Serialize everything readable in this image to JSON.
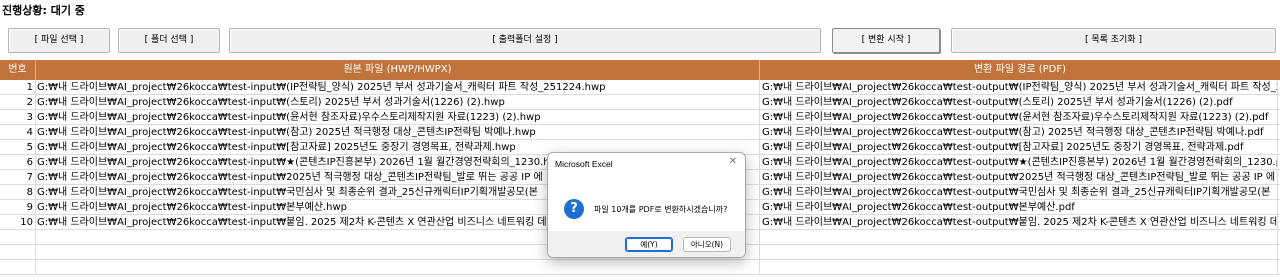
{
  "status_text": "진행상황: 대기 중",
  "buttons": {
    "file_select": "[ 파일 선택 ]",
    "folder_select": "[ 폴더 선택 ]",
    "output_folder": "[ 출력폴더 설정 ]",
    "convert_start": "[ 변환 시작 ]",
    "reset_list": "[ 목록 초기화 ]"
  },
  "table": {
    "headers": [
      "번호",
      "원본 파일 (HWP/HWPX)",
      "변환 파일 경로 (PDF)"
    ],
    "rows": [
      {
        "no": "1",
        "src": "G:₩내 드라이브₩AI_project₩26kocca₩test-input₩(IP전략팀_양식) 2025년 부서 성과기술서_캐릭터 파트 작성_251224.hwp",
        "dst": "G:₩내 드라이브₩AI_project₩26kocca₩test-output₩(IP전략팀_양식) 2025년 부서 성과기술서_캐릭터 파트 작성_2"
      },
      {
        "no": "2",
        "src": "G:₩내 드라이브₩AI_project₩26kocca₩test-input₩(스토리) 2025년 부서 성과기술서(1226) (2).hwp",
        "dst": "G:₩내 드라이브₩AI_project₩26kocca₩test-output₩(스토리) 2025년 부서 성과기술서(1226) (2).pdf"
      },
      {
        "no": "3",
        "src": "G:₩내 드라이브₩AI_project₩26kocca₩test-input₩(윤서현 참조자료)우수스토리제작지원 자료(1223) (2).hwp",
        "dst": "G:₩내 드라이브₩AI_project₩26kocca₩test-output₩(윤서현 참조자료)우수스토리제작지원 자료(1223) (2).pdf"
      },
      {
        "no": "4",
        "src": "G:₩내 드라이브₩AI_project₩26kocca₩test-input₩(참고) 2025년 적극행정 대상_콘텐츠IP전략팀 박예나.hwp",
        "dst": "G:₩내 드라이브₩AI_project₩26kocca₩test-output₩(참고) 2025년 적극행정 대상_콘텐츠IP전략팀 박예나.pdf"
      },
      {
        "no": "5",
        "src": "G:₩내 드라이브₩AI_project₩26kocca₩test-input₩[참고자료] 2025년도 중장기 경영목표, 전략과제.hwp",
        "dst": "G:₩내 드라이브₩AI_project₩26kocca₩test-output₩[참고자료] 2025년도 중장기 경영목표, 전략과제.pdf"
      },
      {
        "no": "6",
        "src": "G:₩내 드라이브₩AI_project₩26kocca₩test-input₩★(콘텐츠IP진흥본부) 2026년 1월 월간경영전략회의_1230.hw",
        "dst": "G:₩내 드라이브₩AI_project₩26kocca₩test-output₩★(콘텐츠IP진흥본부) 2026년 1월 월간경영전략회의_1230.pd"
      },
      {
        "no": "7",
        "src": "G:₩내 드라이브₩AI_project₩26kocca₩test-input₩2025년 적극행정 대상_콘텐츠IP전략팀_발로 뛰는 공공 IP 에",
        "dst": "G:₩내 드라이브₩AI_project₩26kocca₩test-output₩2025년 적극행정 대상_콘텐츠IP전략팀_발로 뛰는 공공 IP 에"
      },
      {
        "no": "8",
        "src": "G:₩내 드라이브₩AI_project₩26kocca₩test-input₩국민심사 및 최종순위 결과_25신규캐릭터IP기획개발공모(본",
        "dst": "G:₩내 드라이브₩AI_project₩26kocca₩test-output₩국민심사 및 최종순위 결과_25신규캐릭터IP기획개발공모(본"
      },
      {
        "no": "9",
        "src": "G:₩내 드라이브₩AI_project₩26kocca₩test-input₩본부예산.hwp",
        "dst": "G:₩내 드라이브₩AI_project₩26kocca₩test-output₩본부예산.pdf"
      },
      {
        "no": "10",
        "src": "G:₩내 드라이브₩AI_project₩26kocca₩test-input₩붙임. 2025 제2차 K-콘텐츠 X 연관산업 비즈니스 네트워킹 데",
        "dst": "G:₩내 드라이브₩AI_project₩26kocca₩test-output₩붙임. 2025 제2차 K-콘텐츠 X 연관산업 비즈니스 네트워킹 데"
      }
    ]
  },
  "dialog": {
    "title": "Microsoft Excel",
    "close_glyph": "✕",
    "icon_glyph": "?",
    "message": "파일 10개를 PDF로 변환하시겠습니까?",
    "yes_label": "예(Y)",
    "no_label": "아니오(N)"
  },
  "colors": {
    "header_bg": "#c0733a",
    "header_text": "#ffffff",
    "question_icon": "#1f6fd0"
  }
}
